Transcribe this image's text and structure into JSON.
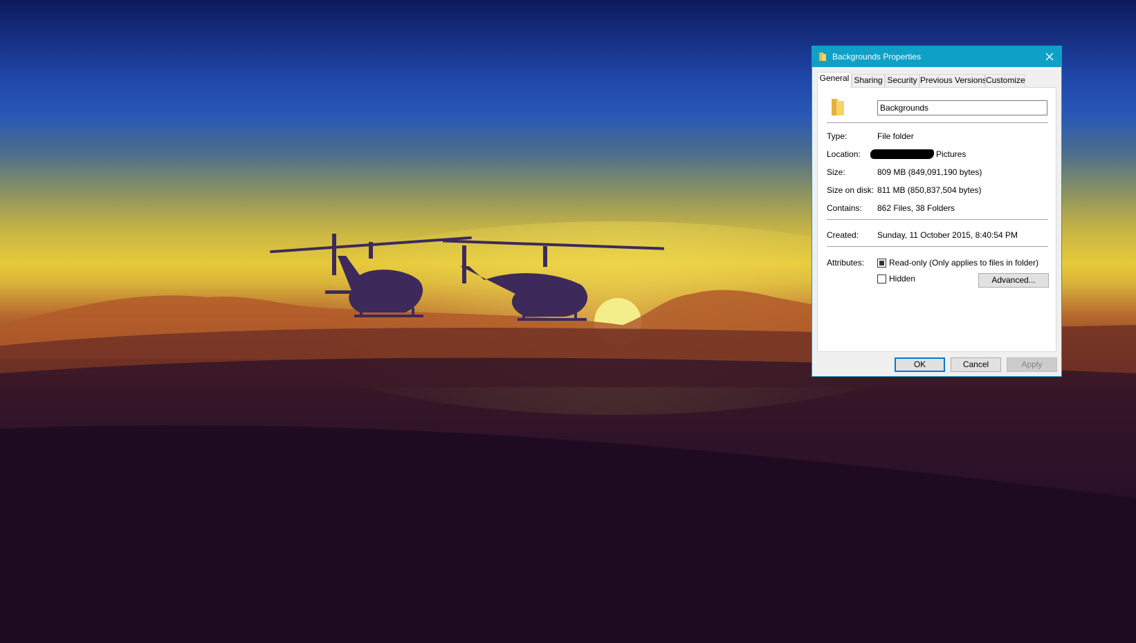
{
  "dialog": {
    "title": "Backgrounds Properties",
    "tabs": [
      "General",
      "Sharing",
      "Security",
      "Previous Versions",
      "Customize"
    ],
    "active_tab": "General",
    "name_value": "Backgrounds",
    "fields": {
      "type_label": "Type:",
      "type_value": "File folder",
      "location_label": "Location:",
      "location_value": "Pictures",
      "size_label": "Size:",
      "size_value": "809 MB (849,091,190 bytes)",
      "size_on_disk_label": "Size on disk:",
      "size_on_disk_value": "811 MB (850,837,504 bytes)",
      "contains_label": "Contains:",
      "contains_value": "862 Files, 38 Folders",
      "created_label": "Created:",
      "created_value": "Sunday, 11 October 2015, 8:40:54 PM",
      "attributes_label": "Attributes:"
    },
    "attributes": {
      "readonly_label": "Read-only (Only applies to files in folder)",
      "readonly_state": "indeterminate",
      "hidden_label": "Hidden",
      "hidden_state": "unchecked",
      "advanced_label": "Advanced..."
    },
    "buttons": {
      "ok": "OK",
      "cancel": "Cancel",
      "apply": "Apply"
    },
    "colors": {
      "titlebar": "#0fa0c6",
      "folder": "#f5d367",
      "default_button_border": "#0078d7"
    },
    "icons": {
      "title_icon": "folder-icon",
      "close_icon": "close-icon",
      "large_icon": "folder-icon"
    }
  },
  "desktop": {
    "wallpaper": "helicopters-at-sunset"
  }
}
